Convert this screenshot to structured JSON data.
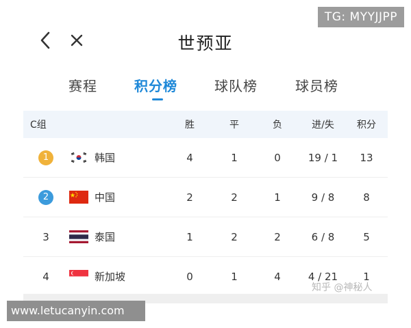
{
  "watermark_top": "TG: MYYJJPP",
  "watermark_bottom": "www.letucanyin.com",
  "watermark_zhihu": "知乎 @神秘人",
  "header": {
    "title": "世预亚",
    "back_icon": "chevron-left-icon",
    "close_icon": "close-icon"
  },
  "tabs": [
    {
      "label": "赛程",
      "active": false
    },
    {
      "label": "积分榜",
      "active": true
    },
    {
      "label": "球队榜",
      "active": false
    },
    {
      "label": "球员榜",
      "active": false
    }
  ],
  "accent_color": "#1e88d8",
  "table": {
    "group_label": "C组",
    "columns": {
      "w": "胜",
      "d": "平",
      "l": "负",
      "gf": "进/失",
      "pts": "积分"
    },
    "rows": [
      {
        "rank": "1",
        "team": "韩国",
        "flag": "korea-flag-icon",
        "w": "4",
        "d": "1",
        "l": "0",
        "gf": "19 / 1",
        "pts": "13"
      },
      {
        "rank": "2",
        "team": "中国",
        "flag": "china-flag-icon",
        "w": "2",
        "d": "2",
        "l": "1",
        "gf": "9 / 8",
        "pts": "8"
      },
      {
        "rank": "3",
        "team": "泰国",
        "flag": "thailand-flag-icon",
        "w": "1",
        "d": "2",
        "l": "2",
        "gf": "6 / 8",
        "pts": "5"
      },
      {
        "rank": "4",
        "team": "新加坡",
        "flag": "singapore-flag-icon",
        "w": "0",
        "d": "1",
        "l": "4",
        "gf": "4 / 21",
        "pts": "1"
      }
    ]
  }
}
